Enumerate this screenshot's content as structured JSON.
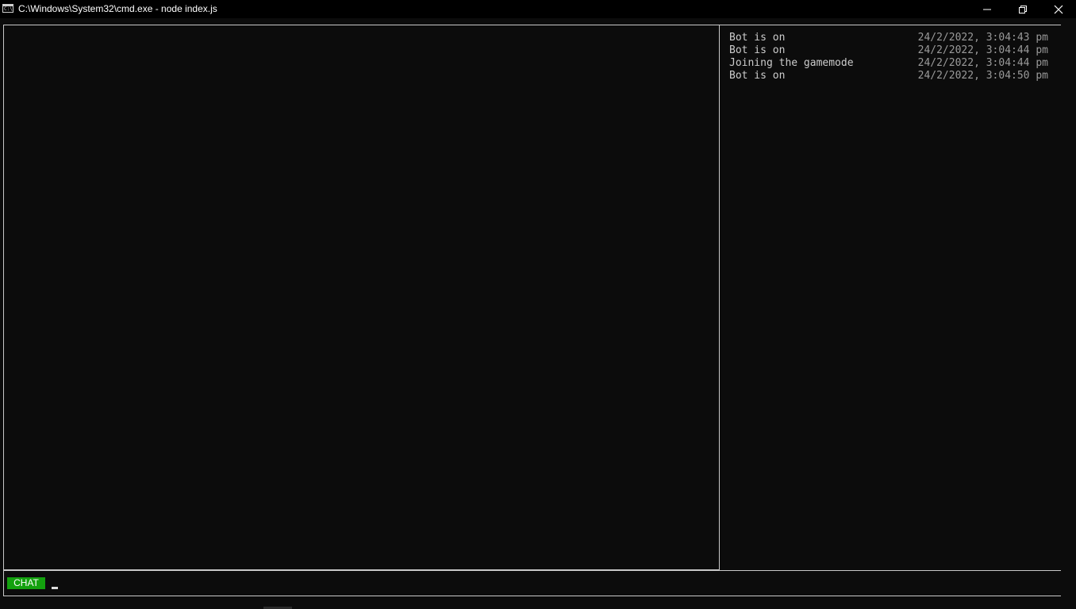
{
  "window": {
    "title": "C:\\Windows\\System32\\cmd.exe - node  index.js",
    "icon": "cmd-icon",
    "icon_text": "C:\\",
    "controls": {
      "minimize": "minimize-icon",
      "maximize": "restore-icon",
      "close": "close-icon"
    }
  },
  "log": {
    "entries": [
      {
        "message": "Bot is on",
        "time": "24/2/2022, 3:04:43 pm"
      },
      {
        "message": "Bot is on",
        "time": "24/2/2022, 3:04:44 pm"
      },
      {
        "message": "Joining the gamemode",
        "time": "24/2/2022, 3:04:44 pm"
      },
      {
        "message": "Bot is on",
        "time": "24/2/2022, 3:04:50 pm"
      }
    ]
  },
  "input": {
    "label": "CHAT",
    "value": ""
  },
  "colors": {
    "background": "#0c0c0c",
    "border": "#c9c9c9",
    "chat_label_bg": "#13a10e",
    "text": "#cccccc",
    "timestamp": "#9a9a9a"
  }
}
